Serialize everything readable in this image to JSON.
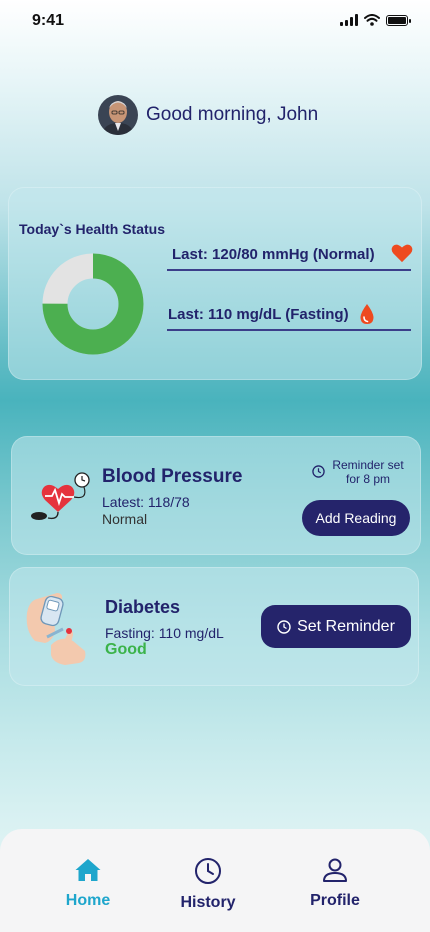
{
  "status_bar": {
    "time": "9:41"
  },
  "greeting": {
    "text": "Good morning,  John"
  },
  "health_status": {
    "title": "Today`s Health Status",
    "blood_pressure_reading": "Last: 120/80 mmHg (Normal)",
    "glucose_reading": "Last: 110 mg/dL (Fasting)",
    "donut": {
      "green_fraction": 0.75,
      "colors": {
        "primary": "#4caf50",
        "secondary": "#e3e3e3"
      }
    }
  },
  "blood_pressure": {
    "title": "Blood Pressure",
    "latest": "Latest: 118/78",
    "status": "Normal",
    "reminder_line1": "Reminder set",
    "reminder_line2": "for 8 pm",
    "button_label": "Add Reading"
  },
  "diabetes": {
    "title": "Diabetes",
    "fasting": "Fasting: 110 mg/dL",
    "status": "Good",
    "button_label": "Set Reminder"
  },
  "nav": {
    "items": [
      {
        "label": "Home",
        "icon": "home-icon",
        "active": true
      },
      {
        "label": "History",
        "icon": "clock-icon",
        "active": false
      },
      {
        "label": "Profile",
        "icon": "user-icon",
        "active": false
      }
    ]
  },
  "colors": {
    "navy": "#25246b",
    "accent": "#1ea6cc",
    "good": "#3bb34a",
    "heart": "#ee4a1f"
  }
}
